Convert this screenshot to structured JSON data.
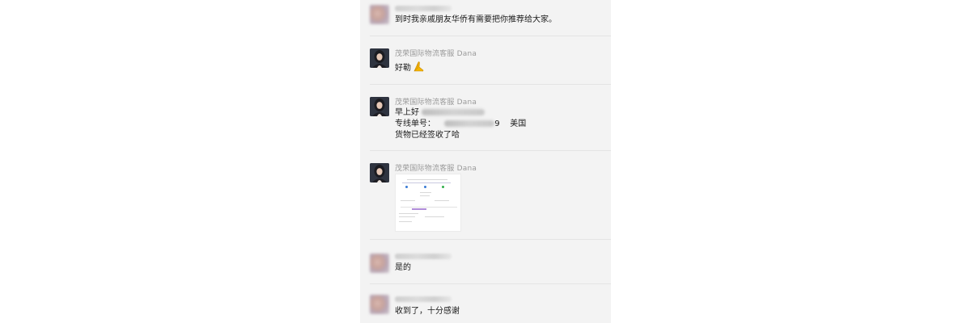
{
  "chat": {
    "messages": [
      {
        "sender": "",
        "sender_blurred": true,
        "avatar": "blurred-avatar",
        "text": "到时我亲戚朋友华侨有需要把你推荐给大家。"
      },
      {
        "sender": "茂荣国际物流客服 Dana",
        "avatar": "agent-avatar",
        "text": "好勒",
        "emoji": "folded-hands-icon"
      },
      {
        "sender": "茂荣国际物流客服 Dana",
        "avatar": "agent-avatar",
        "lines": [
          {
            "prefix": "早上好",
            "suffix": ""
          },
          {
            "prefix": "专线单号：",
            "suffix": "9    美国"
          },
          {
            "prefix": "货物已经签收了哈",
            "suffix": ""
          }
        ]
      },
      {
        "sender": "茂荣国际物流客服 Dana",
        "avatar": "agent-avatar",
        "attachment": "screenshot-thumbnail"
      },
      {
        "sender": "",
        "sender_blurred": true,
        "avatar": "blurred-avatar",
        "text": "是的"
      },
      {
        "sender": "",
        "sender_blurred": true,
        "avatar": "blurred-avatar",
        "text": "收到了，十分感谢"
      }
    ]
  },
  "colors": {
    "panel_bg": "#f3f3f3",
    "divider": "#e4e4e4",
    "sender_text": "#9a9a9a",
    "message_text": "#1a1a1a",
    "emoji_yellow": "#f5b400"
  }
}
